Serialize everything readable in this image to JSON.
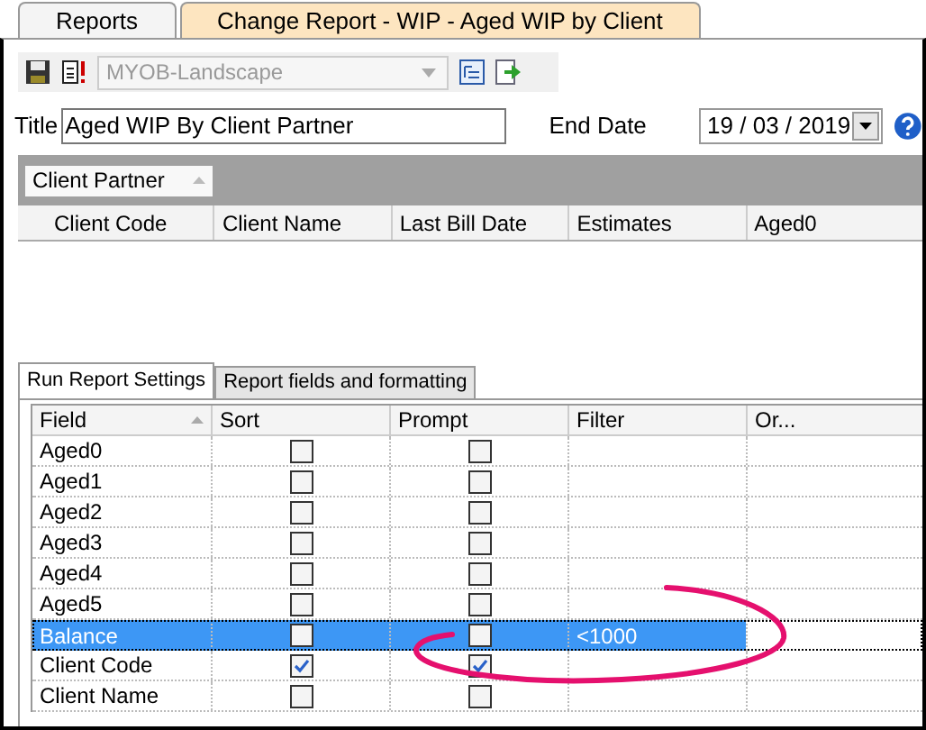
{
  "tabs": [
    {
      "label": "Reports",
      "selected": false
    },
    {
      "label": "Change Report - WIP - Aged WIP by Client",
      "selected": true
    }
  ],
  "toolbar": {
    "layout": {
      "value": "MYOB-Landscape",
      "disabled": true
    }
  },
  "title_field": {
    "label": "Title",
    "value": "Aged WIP By Client Partner"
  },
  "end_date": {
    "label": "End Date",
    "value": "19 / 03 / 2019"
  },
  "group_by": {
    "label": "Client Partner"
  },
  "report_columns": [
    "Client Code",
    "Client Name",
    "Last Bill Date",
    "Estimates",
    "Aged0"
  ],
  "settings_tabs": [
    {
      "label": "Run Report Settings",
      "selected": true
    },
    {
      "label": "Report fields and formatting",
      "selected": false
    }
  ],
  "grid": {
    "columns": [
      "Field",
      "Sort",
      "Prompt",
      "Filter",
      "Or..."
    ],
    "rows": [
      {
        "field": "Aged0",
        "sort": false,
        "prompt": false,
        "filter": "",
        "selected": false
      },
      {
        "field": "Aged1",
        "sort": false,
        "prompt": false,
        "filter": "",
        "selected": false
      },
      {
        "field": "Aged2",
        "sort": false,
        "prompt": false,
        "filter": "",
        "selected": false
      },
      {
        "field": "Aged3",
        "sort": false,
        "prompt": false,
        "filter": "",
        "selected": false
      },
      {
        "field": "Aged4",
        "sort": false,
        "prompt": false,
        "filter": "",
        "selected": false
      },
      {
        "field": "Aged5",
        "sort": false,
        "prompt": false,
        "filter": "",
        "selected": false
      },
      {
        "field": "Balance",
        "sort": false,
        "prompt": false,
        "filter": "<1000",
        "selected": true
      },
      {
        "field": "Client Code",
        "sort": true,
        "prompt": true,
        "filter": "",
        "selected": false
      },
      {
        "field": "Client Name",
        "sort": false,
        "prompt": false,
        "filter": "",
        "selected": false
      }
    ]
  }
}
